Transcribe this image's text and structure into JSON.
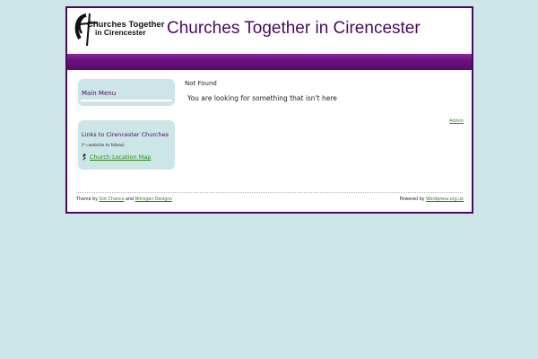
{
  "header": {
    "logo_line1": "Churches Together",
    "logo_line2": "in Cirencester",
    "site_title": "Churches Together in Cirencester"
  },
  "sidebar": {
    "main_menu_title": "Main Menu",
    "links_title": "Links to Cirencester Churches",
    "links_note": "(*=website to follow)",
    "church_location_map": "Church Location Map",
    "link_icon": "church-bullet-icon"
  },
  "content": {
    "heading": "Not Found",
    "message": "You are looking for something that isn't here",
    "admin_link": "Admin"
  },
  "footer": {
    "theme_by_prefix": "Theme by",
    "theme_link1": "Got Chance",
    "and_word": "and",
    "theme_link2": "Nitrogen Designs",
    "powered_by": "Powered by",
    "powered_link1": "Wordpress",
    "powered_link2": ".org.uk"
  },
  "colors": {
    "background": "#cce5e6",
    "accent": "#4a0a5e",
    "link": "#2a8a12"
  }
}
